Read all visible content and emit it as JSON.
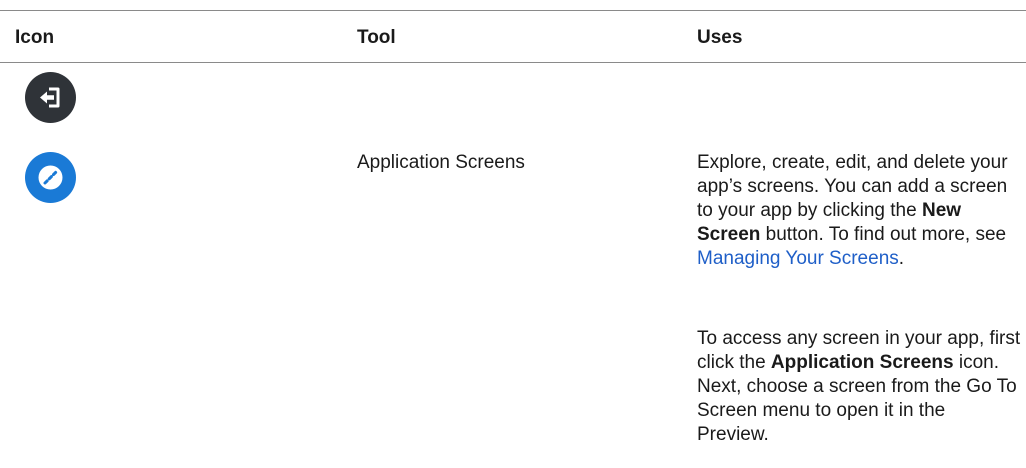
{
  "table": {
    "headers": {
      "icon": "Icon",
      "tool": "Tool",
      "uses": "Uses"
    },
    "rows": [
      {
        "icon": "back-arrow-icon",
        "icon_color": "#2f3338",
        "tool": "",
        "uses": ""
      },
      {
        "icon": "application-screens-icon",
        "icon_color": "#1a7ad6",
        "tool": "Application Screens",
        "uses_p1": {
          "t1": "Explore, create, edit, and delete your app’s screens. You can add a screen to your app by clicking the ",
          "b1": "New Screen",
          "t2": " button. To find out more, see ",
          "link": "Managing Your Screens",
          "t3": "."
        },
        "uses_p2": {
          "t1": "To access any screen in your app, first click the ",
          "b1": "Application Screens",
          "t2": " icon. Next, choose a screen from the Go To Screen menu to open it in the Preview."
        }
      }
    ]
  },
  "colors": {
    "link": "#1f5fc8",
    "rule": "#8a8a8a"
  }
}
